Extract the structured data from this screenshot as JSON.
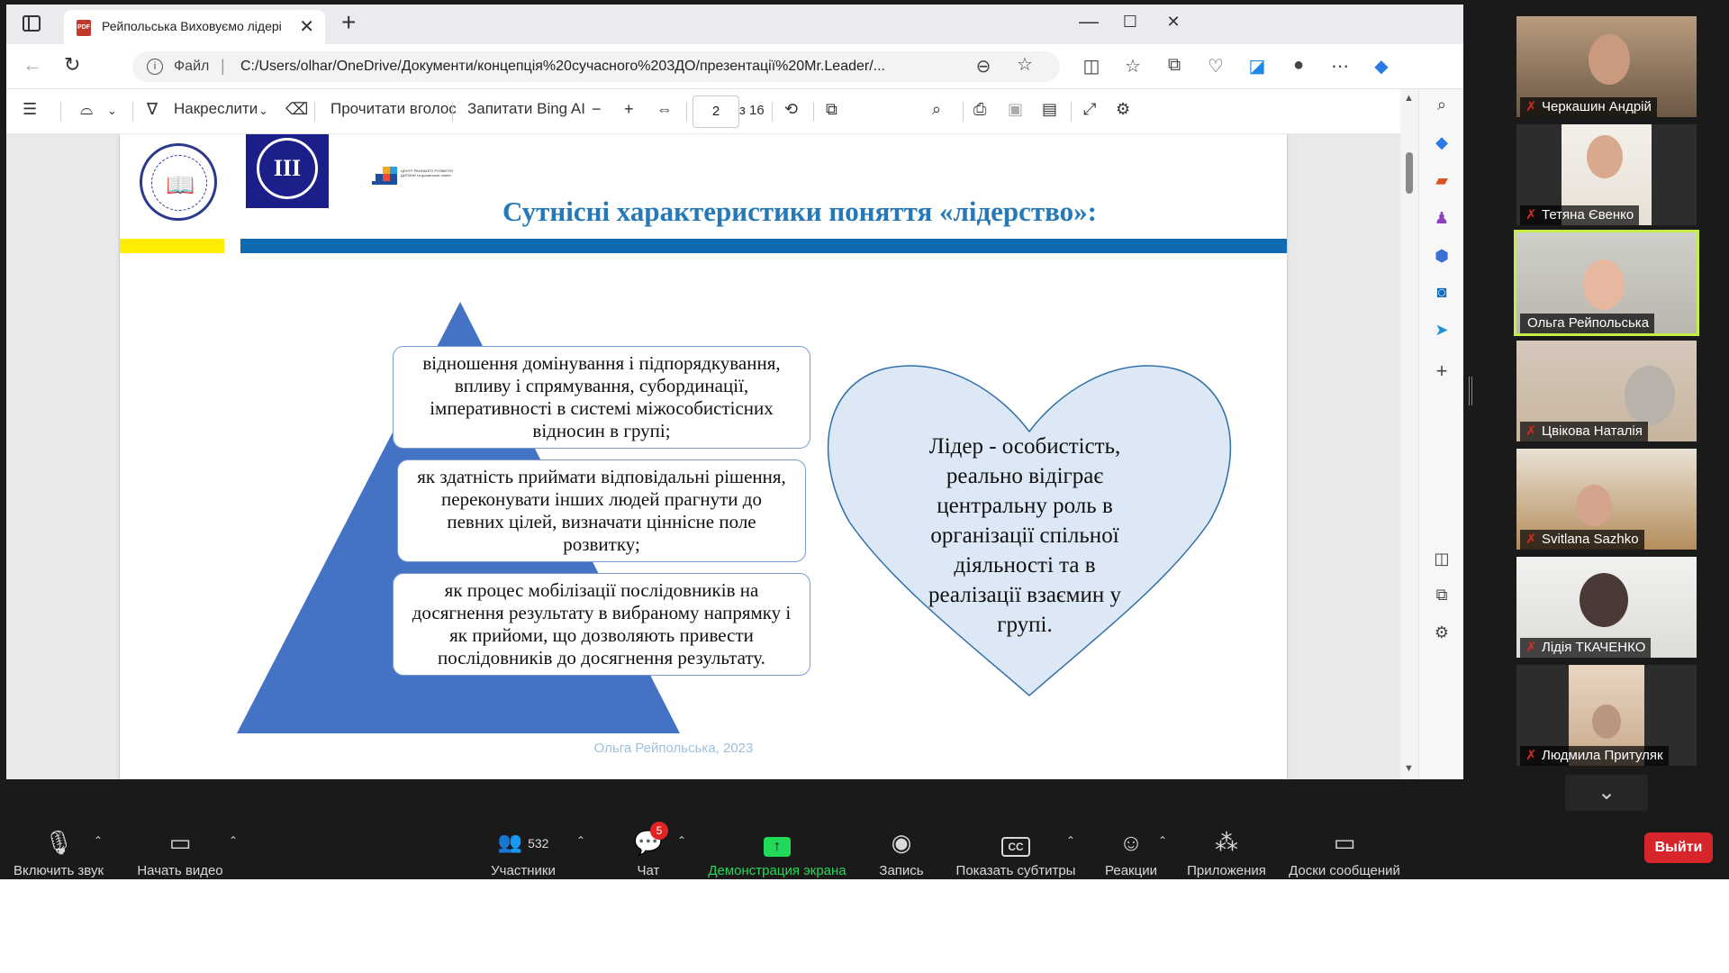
{
  "browser": {
    "tab_title": "Рейпольська Виховуємо лідері",
    "pdf_fav": "PDF",
    "protocol_label": "Файл",
    "url": "C:/Users/olhar/OneDrive/Документи/концепція%20сучасного%203ДО/презентації%20Mr.Leader/...",
    "new_tab": "+",
    "minimize": "—",
    "maximize": "☐",
    "close": "✕"
  },
  "pdf_toolbar": {
    "draw_label": "Накреслити",
    "read_aloud_label": "Прочитати вголос",
    "ask_bing_label": "Запитати Bing AI",
    "page_current": "2",
    "page_total": "з 16"
  },
  "slide": {
    "title": "Сутнісні характеристики поняття «лідерство»:",
    "logo2_text": "ІІІ",
    "logo3_text": "ЦЕНТР РАННЬОГО РОЗВИТКУ ДИТИНИ та дошкільної освіти",
    "pyramid_items": [
      "відношення домінування і підпорядкування, впливу і спрямування, субординації, імперативності в системі міжособистісних відносин в групі;",
      "як здатність приймати відповідальні рішення, переконувати інших людей прагнути до певних цілей, визначати ціннісне поле розвитку;",
      "як процес мобілізації послідовників на досягнення результату в вибраному напрямку і як прийоми, що дозволяють привести послідовників до досягнення результату."
    ],
    "heart_text": "Лідер - особистість, реально відіграє центральну роль в організації спільної діяльності та в реалізації взаємин у групі.",
    "footer": "Ольга Рейпольська, 2023"
  },
  "participants": [
    {
      "name": "Черкашин Андрій",
      "muted": true
    },
    {
      "name": "Тетяна Євенко",
      "muted": true
    },
    {
      "name": "Ольга Рейпольська",
      "muted": false
    },
    {
      "name": "Цвікова Наталія",
      "muted": true
    },
    {
      "name": "Svitlana Sazhko",
      "muted": true
    },
    {
      "name": "Лідія ТКАЧЕНКО",
      "muted": true
    },
    {
      "name": "Людмила Притуляк",
      "muted": true
    }
  ],
  "zoom_controls": {
    "unmute": "Включить звук",
    "start_video": "Начать видео",
    "participants": "Участники",
    "participants_count": "532",
    "chat": "Чат",
    "chat_badge": "5",
    "share_screen": "Демонстрация экрана",
    "record": "Запись",
    "captions": "Показать субтитры",
    "captions_icon": "CC",
    "reactions": "Реакции",
    "apps": "Приложения",
    "whiteboards": "Доски сообщений",
    "leave": "Выйти"
  },
  "colors": {
    "title_blue": "#2579b8",
    "stripe_yellow": "#ffee00",
    "stripe_blue": "#0f6ab4",
    "pyramid_blue": "#4472c4",
    "heart_fill": "#dde8f6",
    "share_green": "#23d959",
    "leave_red": "#d7262b",
    "active_speaker": "#c6ec47"
  }
}
